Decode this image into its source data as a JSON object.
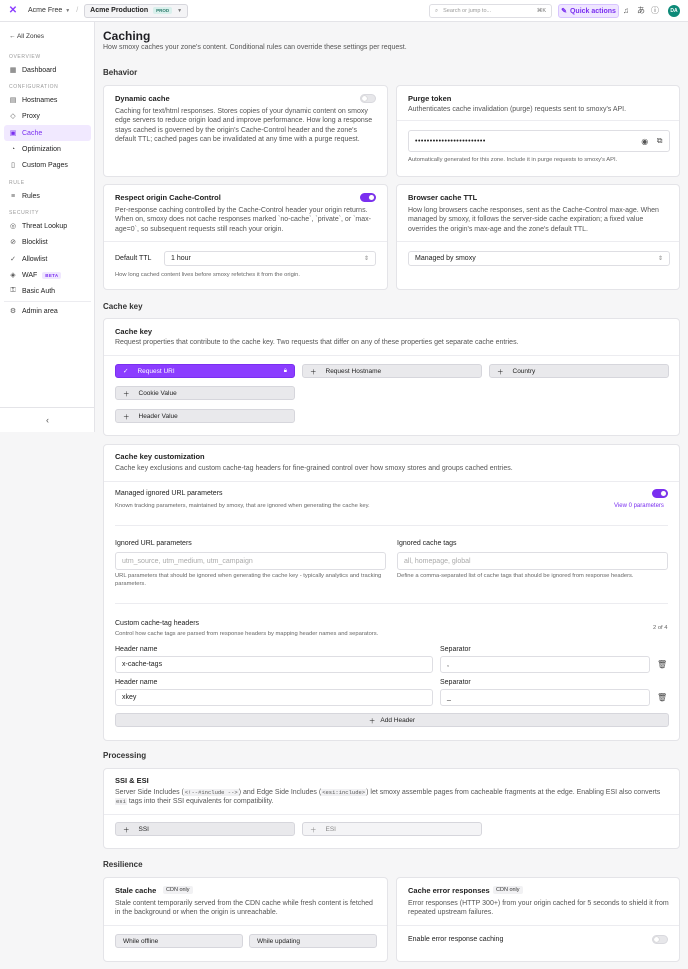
{
  "topbar": {
    "org": "Acme Free",
    "zone": "Acme Production",
    "zone_badge": "PROD",
    "search_placeholder": "Search or jump to...",
    "search_kbd": "⌘K",
    "quick_actions": "Quick actions",
    "avatar": "DA"
  },
  "sidebar": {
    "back": "All Zones",
    "sections": {
      "overview": "OVERVIEW",
      "configuration": "CONFIGURATION",
      "rule": "RULE",
      "security": "SECURITY"
    },
    "items": {
      "dashboard": "Dashboard",
      "hostnames": "Hostnames",
      "proxy": "Proxy",
      "cache": "Cache",
      "optimization": "Optimization",
      "custom_pages": "Custom Pages",
      "rules": "Rules",
      "threat_lookup": "Threat Lookup",
      "blocklist": "Blocklist",
      "allowlist": "Allowlist",
      "waf": "WAF",
      "waf_badge": "BETA",
      "basic_auth": "Basic Auth",
      "admin_area": "Admin area"
    }
  },
  "page": {
    "title": "Caching",
    "subtitle": "How smoxy caches your zone's content. Conditional rules can override these settings per request."
  },
  "behavior": {
    "heading": "Behavior",
    "dynamic_cache": {
      "title": "Dynamic cache",
      "desc": "Caching for text/html responses. Stores copies of your dynamic content on smoxy edge servers to reduce origin load and improve performance. How long a response stays cached is governed by the origin's Cache-Control header and the zone's default TTL; cached pages can be invalidated at any time with a purge request."
    },
    "purge_token": {
      "title": "Purge token",
      "desc": "Authenticates cache invalidation (purge) requests sent to smoxy's API.",
      "value": "••••••••••••••••••••••••",
      "help": "Automatically generated for this zone. Include it in purge requests to smoxy's API."
    },
    "respect_origin": {
      "title": "Respect origin Cache-Control",
      "desc": "Per-response caching controlled by the Cache-Control header your origin returns. When on, smoxy does not cache responses marked `no-cache`, `private`, or `max-age=0`, so subsequent requests still reach your origin.",
      "ttl_label": "Default TTL",
      "ttl_value": "1 hour",
      "ttl_help": "How long cached content lives before smoxy refetches it from the origin."
    },
    "browser_ttl": {
      "title": "Browser cache TTL",
      "desc": "How long browsers cache responses, sent as the Cache-Control max-age. When managed by smoxy, it follows the server-side cache expiration; a fixed value overrides the origin's max-age and the zone's default TTL.",
      "value": "Managed by smoxy"
    }
  },
  "cache_key": {
    "heading": "Cache key",
    "title": "Cache key",
    "desc": "Request properties that contribute to the cache key. Two requests that differ on any of these properties get separate cache entries.",
    "chips": {
      "request_uri": "Request URI",
      "request_hostname": "Request Hostname",
      "country": "Country",
      "cookie_value": "Cookie Value",
      "header_value": "Header Value"
    }
  },
  "customization": {
    "title": "Cache key customization",
    "desc": "Cache key exclusions and custom cache-tag headers for fine-grained control over how smoxy stores and groups cached entries.",
    "managed": {
      "title": "Managed ignored URL parameters",
      "desc": "Known tracking parameters, maintained by smoxy, that are ignored when generating the cache key.",
      "link": "View 0 parameters"
    },
    "ignored_params": {
      "label": "Ignored URL parameters",
      "placeholder": "utm_source, utm_medium, utm_campaign",
      "help": "URL parameters that should be ignored when generating the cache key - typically analytics and tracking parameters."
    },
    "ignored_tags": {
      "label": "Ignored cache tags",
      "placeholder": "all, homepage, global",
      "help": "Define a comma-separated list of cache tags that should be ignored from response headers."
    },
    "custom_tags": {
      "title": "Custom cache-tag headers",
      "desc": "Control how cache tags are parsed from response headers by mapping header names and separators.",
      "count": "2 of 4",
      "header_label": "Header name",
      "sep_label": "Separator",
      "rows": [
        {
          "name": "x-cache-tags",
          "sep": ","
        },
        {
          "name": "xkey",
          "sep": "_"
        }
      ],
      "add": "Add Header"
    }
  },
  "processing": {
    "heading": "Processing",
    "title": "SSI & ESI",
    "desc_a": "Server Side Includes (",
    "code_a": "&lt;!--#include --&gt;",
    "desc_b": ") and Edge Side Includes (",
    "code_b": "&lt;esi:include&gt;",
    "desc_c": ") let smoxy assemble pages from cacheable fragments at the edge. Enabling ESI also converts ",
    "code_c": "esi",
    "desc_d": " tags into their SSI equivalents for compatibility.",
    "ssi": "SSI",
    "esi": "ESI"
  },
  "resilience": {
    "heading": "Resilience",
    "stale": {
      "title": "Stale cache",
      "badge": "CDN only",
      "desc": "Stale content temporarily served from the CDN cache while fresh content is fetched in the background or when the origin is unreachable.",
      "opt1": "While offline",
      "opt2": "While updating"
    },
    "errors": {
      "title": "Cache error responses",
      "badge": "CDN only",
      "desc": "Error responses (HTTP 300+) from your origin cached for 5 seconds to shield it from repeated upstream failures.",
      "toggle_label": "Enable error response caching"
    }
  }
}
